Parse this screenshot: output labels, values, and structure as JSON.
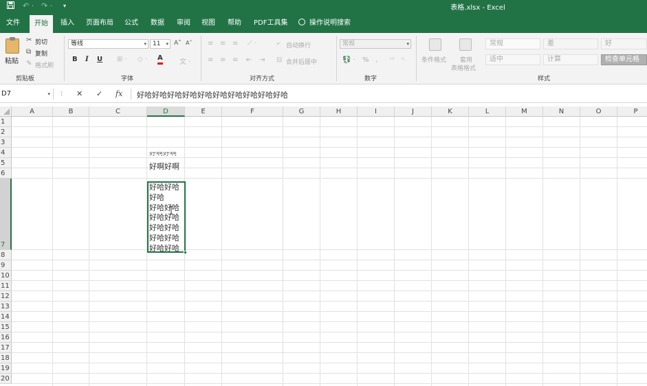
{
  "title_bar": {
    "title": "表格.xlsx  -  Excel",
    "save_icon": "save-icon",
    "undo_icon": "undo-icon",
    "redo_icon": "redo-icon",
    "customize_icon": "customize-qat-icon"
  },
  "tabs": [
    "文件",
    "开始",
    "插入",
    "页面布局",
    "公式",
    "数据",
    "审阅",
    "视图",
    "帮助",
    "PDF工具集"
  ],
  "active_tab": "开始",
  "tell_me": "操作说明搜索",
  "ribbon": {
    "clipboard": {
      "paste": "粘贴",
      "cut": "剪切",
      "copy": "复制",
      "format_painter": "格式刷",
      "label": "剪贴板"
    },
    "font": {
      "font_name": "等线",
      "font_size": "11",
      "bold": "B",
      "italic": "I",
      "underline": "U",
      "font_color_glyph": "A",
      "label": "字体"
    },
    "alignment": {
      "wrap_text": "自动换行",
      "merge_center": "合并后居中",
      "label": "对齐方式"
    },
    "number": {
      "format": "常规",
      "percent": "%",
      "label": "数字"
    },
    "styles": {
      "conditional_format": "条件格式",
      "table_format_line1": "套用",
      "table_format_line2": "表格格式",
      "normal": "常规",
      "bad": "差",
      "good": "好",
      "neutral": "适中",
      "calculation": "计算",
      "check_cell": "检查单元格",
      "label": "样式"
    }
  },
  "formula_bar": {
    "name_box": "D7",
    "cancel": "✕",
    "enter": "✓",
    "fx": "fx",
    "content": "好哈好哈好哈好哈好哈好哈好哈好哈好哈好哈"
  },
  "columns": [
    "A",
    "B",
    "C",
    "D",
    "E",
    "F",
    "G",
    "H",
    "I",
    "J",
    "K",
    "L",
    "M",
    "N",
    "O",
    "P"
  ],
  "rows": [
    "1",
    "2",
    "3",
    "4",
    "5",
    "6",
    "7",
    "8",
    "9",
    "10",
    "11",
    "12",
    "13",
    "14",
    "15",
    "16",
    "17",
    "18",
    "19",
    "20"
  ],
  "selected_column": "D",
  "selected_row": "7",
  "cells": {
    "D4_clipped": "好啊好啊",
    "D5": "好啊好啊",
    "D7_lines": [
      "好哈好哈",
      "好哈",
      "好哈好哈",
      "好哈好哈",
      "好哈好哈",
      "好哈好哈",
      "好哈好哈"
    ]
  }
}
